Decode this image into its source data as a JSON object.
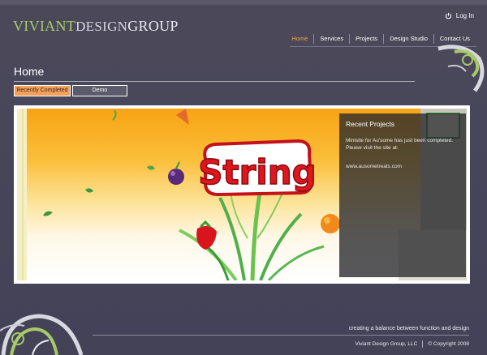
{
  "header": {
    "logo": {
      "part1": "VIVIANT",
      "part2": "DESIGN",
      "part3": "GROUP"
    },
    "login_label": "Log In",
    "nav": [
      {
        "label": "Home",
        "active": true
      },
      {
        "label": "Services",
        "active": false
      },
      {
        "label": "Projects",
        "active": false
      },
      {
        "label": "Design Studio",
        "active": false
      },
      {
        "label": "Contact Us",
        "active": false
      }
    ]
  },
  "main": {
    "title": "Home",
    "tabs": [
      {
        "label": "Recently Completed",
        "active": true
      },
      {
        "label": "Demo",
        "active": false
      }
    ],
    "banner": {
      "logo_text": "String",
      "panel": {
        "heading": "Recent Projects",
        "body": "Minisite for Au'some has just been completed. Please visit the site at:",
        "link": "www.ausometreats.com"
      }
    }
  },
  "footer": {
    "tagline": "creating a balance between function and design",
    "company": "Viviant Design Group, LLC",
    "copyright": "© Copyright 2008"
  },
  "colors": {
    "background": "#4a4858",
    "accent_orange": "#f0a14a",
    "accent_green": "#a8c96a"
  }
}
